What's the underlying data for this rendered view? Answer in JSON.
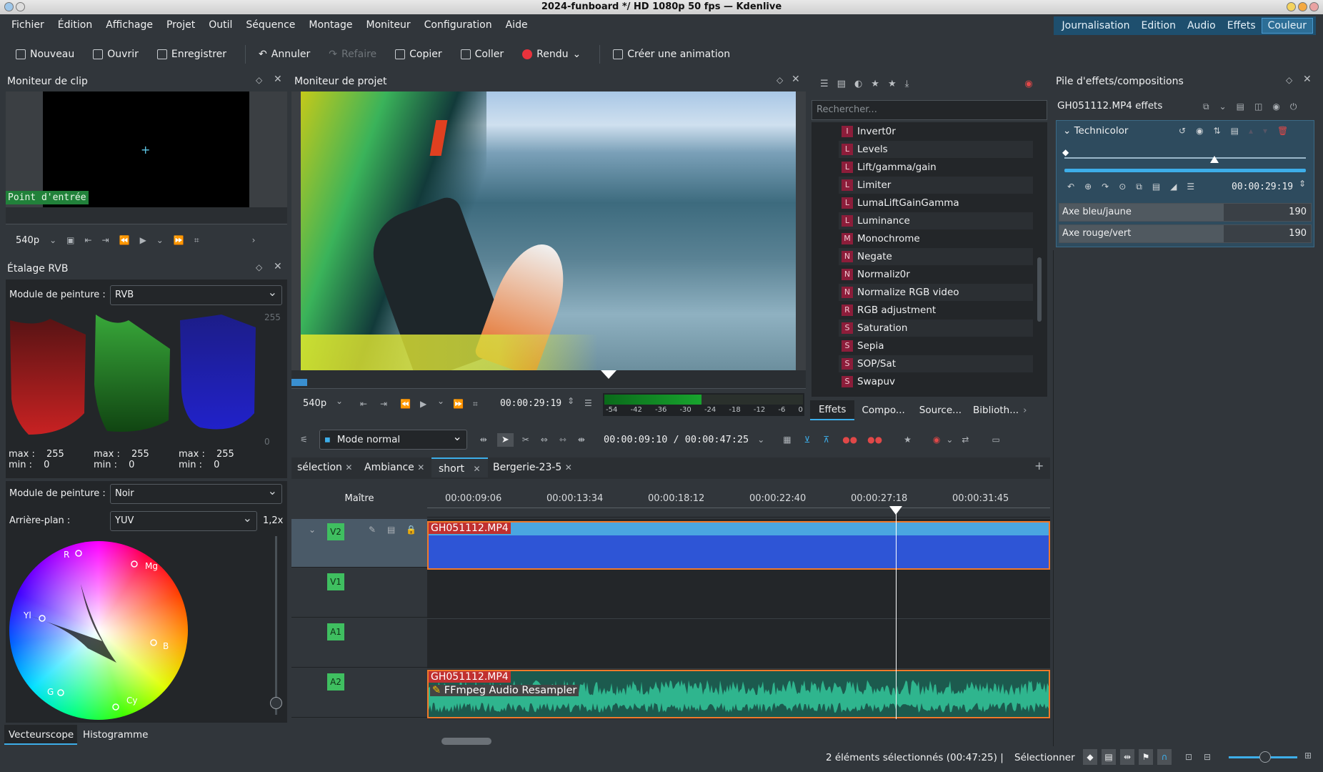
{
  "window": {
    "title": "2024-funboard */ HD 1080p 50 fps — Kdenlive"
  },
  "menu": [
    "Fichier",
    "Édition",
    "Affichage",
    "Projet",
    "Outil",
    "Séquence",
    "Montage",
    "Moniteur",
    "Configuration",
    "Aide"
  ],
  "layouts": [
    "Journalisation",
    "Edition",
    "Audio",
    "Effets",
    "Couleur"
  ],
  "toolbar": {
    "nouveau": "Nouveau",
    "ouvrir": "Ouvrir",
    "enregistrer": "Enregistrer",
    "annuler": "Annuler",
    "refaire": "Refaire",
    "copier": "Copier",
    "coller": "Coller",
    "rendu": "Rendu",
    "animation": "Créer une animation"
  },
  "clip_monitor": {
    "title": "Moniteur de clip",
    "in_point": "Point d'entrée",
    "zoom": "540p"
  },
  "project_monitor": {
    "title": "Moniteur de projet",
    "zoom": "540p",
    "timecode": "00:00:29:19",
    "meter_labels": [
      "-54",
      "-42",
      "-36",
      "-30",
      "-24",
      "-18",
      "-12",
      "-6",
      "0"
    ]
  },
  "rgb_parade": {
    "title": "Étalage RVB",
    "paint_label": "Module de peinture :",
    "paint_value": "RVB",
    "scale_top": "255",
    "scale_bottom": "0",
    "stats": [
      {
        "max": "max :",
        "maxv": "255",
        "min": "min :",
        "minv": "0"
      },
      {
        "max": "max :",
        "maxv": "255",
        "min": "min :",
        "minv": "0"
      },
      {
        "max": "max :",
        "maxv": "255",
        "min": "min :",
        "minv": "0"
      }
    ]
  },
  "vectorscope": {
    "paint_label": "Module de peinture :",
    "paint_value": "Noir",
    "bg_label": "Arrière-plan :",
    "bg_value": "YUV",
    "gain": "1,2x",
    "labels": {
      "r": "R",
      "mg": "Mg",
      "yl": "Yl",
      "b": "B",
      "g": "G",
      "cy": "Cy"
    },
    "tabs": [
      "Vecteurscope",
      "Histogramme"
    ]
  },
  "effects_list": {
    "search_placeholder": "Rechercher...",
    "items": [
      {
        "letter": "I",
        "name": "Invert0r"
      },
      {
        "letter": "L",
        "name": "Levels"
      },
      {
        "letter": "L",
        "name": "Lift/gamma/gain"
      },
      {
        "letter": "L",
        "name": "Limiter"
      },
      {
        "letter": "L",
        "name": "LumaLiftGainGamma"
      },
      {
        "letter": "L",
        "name": "Luminance"
      },
      {
        "letter": "M",
        "name": "Monochrome"
      },
      {
        "letter": "N",
        "name": "Negate"
      },
      {
        "letter": "N",
        "name": "Normaliz0r"
      },
      {
        "letter": "N",
        "name": "Normalize RGB video"
      },
      {
        "letter": "R",
        "name": "RGB adjustment"
      },
      {
        "letter": "S",
        "name": "Saturation"
      },
      {
        "letter": "S",
        "name": "Sepia"
      },
      {
        "letter": "S",
        "name": "SOP/Sat"
      },
      {
        "letter": "S",
        "name": "Swapuv"
      }
    ],
    "tabs": [
      "Effets",
      "Compo...",
      "Source...",
      "Biblioth..."
    ]
  },
  "effect_stack": {
    "title": "Pile d'effets/compositions",
    "clip_label": "GH051112.MP4 effets",
    "effect": "Technicolor",
    "timecode": "00:00:29:19",
    "params": [
      {
        "label": "Axe bleu/jaune",
        "value": "190"
      },
      {
        "label": "Axe rouge/vert",
        "value": "190"
      }
    ]
  },
  "timeline": {
    "mode": "Mode normal",
    "position": "00:00:09:10 / 00:00:47:25",
    "tabs": [
      "sélection",
      "Ambiance",
      "short",
      "Bergerie-23-5"
    ],
    "master": "Maître",
    "ruler": [
      "00:00:09:06",
      "00:00:13:34",
      "00:00:18:12",
      "00:00:22:40",
      "00:00:27:18",
      "00:00:31:45"
    ],
    "tracks": [
      {
        "tag": "V2",
        "clip": "GH051112.MP4"
      },
      {
        "tag": "V1",
        "clip": ""
      },
      {
        "tag": "A1",
        "clip": ""
      },
      {
        "tag": "A2",
        "clip": "GH051112.MP4",
        "effect": "FFmpeg Audio Resampler"
      }
    ]
  },
  "status": {
    "selection": "2 éléments sélectionnés (00:47:25) |",
    "tool": "Sélectionner"
  }
}
